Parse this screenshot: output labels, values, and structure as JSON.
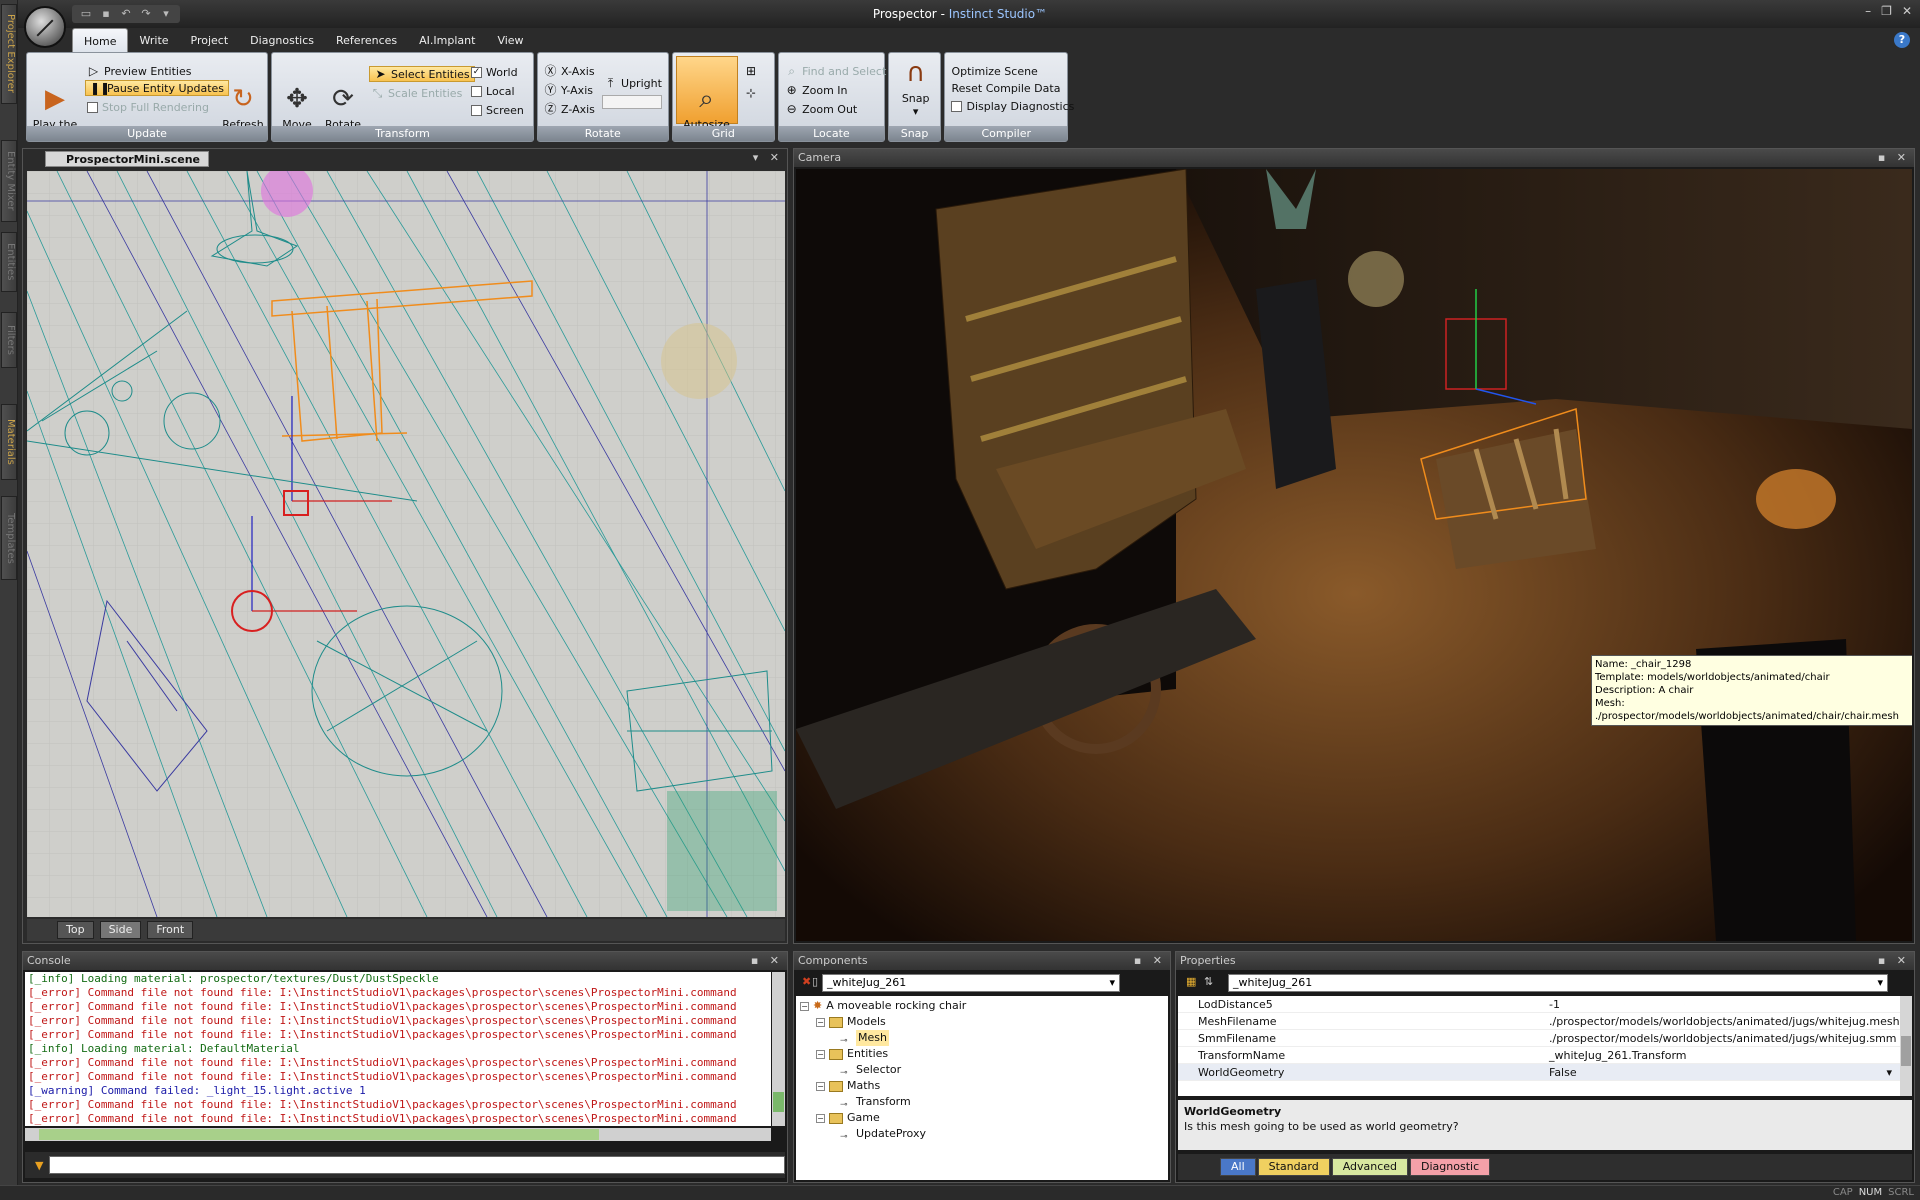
{
  "app": {
    "title": "Prospector",
    "separator": " - ",
    "subtitle": "Instinct Studio™"
  },
  "qat": [
    "open-icon",
    "save-icon",
    "undo-icon",
    "redo-icon",
    "dropdown-icon"
  ],
  "ribbon_tabs": [
    "Home",
    "Write",
    "Project",
    "Diagnostics",
    "References",
    "AI.Implant",
    "View"
  ],
  "ribbon": {
    "update": {
      "label": "Update",
      "play": "Play the\nGame",
      "preview": "Preview Entities",
      "pause": "Pause Entity Updates",
      "stop": "Stop Full Rendering",
      "refresh": "Refresh\nEntities"
    },
    "transform": {
      "label": "Transform",
      "move": "Move\nEntities",
      "rotate": "Rotate\nEntities",
      "select": "Select Entities",
      "scale": "Scale Entities",
      "world": "World",
      "local": "Local",
      "screen": "Screen"
    },
    "rotate": {
      "label": "Rotate",
      "x": "X-Axis",
      "y": "Y-Axis",
      "z": "Z-Axis",
      "upright": "Upright"
    },
    "grid": {
      "label": "Grid",
      "autosize": "Autosize\nMinor Lines"
    },
    "locate": {
      "label": "Locate",
      "find": "Find and Select",
      "zoomin": "Zoom In",
      "zoomout": "Zoom Out"
    },
    "snap": {
      "label": "Snap",
      "snap": "Snap"
    },
    "compiler": {
      "label": "Compiler",
      "optimize": "Optimize Scene",
      "reset": "Reset Compile Data",
      "display": "Display Diagnostics"
    }
  },
  "side_tabs": [
    "Project Explorer",
    "Entity Mixer",
    "Entities",
    "Filters",
    "Materials",
    "Templates"
  ],
  "scene": {
    "tab": "ProspectorMini.scene",
    "views": [
      "Top",
      "Side",
      "Front"
    ]
  },
  "camera": {
    "title": "Camera",
    "tooltip": {
      "name": "Name: _chair_1298",
      "template": "Template: models/worldobjects/animated/chair",
      "description": "Description: A chair",
      "mesh": "Mesh: ./prospector/models/worldobjects/animated/chair/chair.mesh"
    }
  },
  "console": {
    "title": "Console",
    "lines": [
      {
        "level": "info",
        "text": "[_info] Loading material: prospector/textures/Dust/DustSpeckle"
      },
      {
        "level": "error",
        "text": "[_error] Command file not found file: I:\\InstinctStudioV1\\packages\\prospector\\scenes\\ProspectorMini.command"
      },
      {
        "level": "error",
        "text": "[_error] Command file not found file: I:\\InstinctStudioV1\\packages\\prospector\\scenes\\ProspectorMini.command"
      },
      {
        "level": "error",
        "text": "[_error] Command file not found file: I:\\InstinctStudioV1\\packages\\prospector\\scenes\\ProspectorMini.command"
      },
      {
        "level": "error",
        "text": "[_error] Command file not found file: I:\\InstinctStudioV1\\packages\\prospector\\scenes\\ProspectorMini.command"
      },
      {
        "level": "info",
        "text": "[_info] Loading material: DefaultMaterial"
      },
      {
        "level": "error",
        "text": "[_error] Command file not found file: I:\\InstinctStudioV1\\packages\\prospector\\scenes\\ProspectorMini.command"
      },
      {
        "level": "error",
        "text": "[_error] Command file not found file: I:\\InstinctStudioV1\\packages\\prospector\\scenes\\ProspectorMini.command"
      },
      {
        "level": "warning",
        "text": "[_warning] Command failed: _light_15.light.active 1"
      },
      {
        "level": "error",
        "text": "[_error] Command file not found file: I:\\InstinctStudioV1\\packages\\prospector\\scenes\\ProspectorMini.command"
      },
      {
        "level": "error",
        "text": "[_error] Command file not found file: I:\\InstinctStudioV1\\packages\\prospector\\scenes\\ProspectorMini.command"
      }
    ],
    "input": ""
  },
  "components": {
    "title": "Components",
    "selected": "_whiteJug_261",
    "tree": [
      {
        "label": "A moveable rocking chair",
        "type": "root"
      },
      {
        "label": "Models",
        "type": "folder"
      },
      {
        "label": "Mesh",
        "type": "component",
        "selected": true
      },
      {
        "label": "Entities",
        "type": "folder"
      },
      {
        "label": "Selector",
        "type": "component"
      },
      {
        "label": "Maths",
        "type": "folder"
      },
      {
        "label": "Transform",
        "type": "component"
      },
      {
        "label": "Game",
        "type": "folder"
      },
      {
        "label": "UpdateProxy",
        "type": "component"
      }
    ]
  },
  "properties": {
    "title": "Properties",
    "selected": "_whiteJug_261",
    "rows": [
      {
        "name": "LodDistance5",
        "value": "-1"
      },
      {
        "name": "MeshFilename",
        "value": "./prospector/models/worldobjects/animated/jugs/whitejug.mesh"
      },
      {
        "name": "SmmFilename",
        "value": "./prospector/models/worldobjects/animated/jugs/whitejug.smm"
      },
      {
        "name": "TransformName",
        "value": "_whiteJug_261.Transform"
      },
      {
        "name": "WorldGeometry",
        "value": "False",
        "selected": true
      }
    ],
    "desc_title": "WorldGeometry",
    "desc_text": "Is this mesh going to be used as world geometry?",
    "tabs": [
      {
        "label": "All",
        "color": "#4a78c8"
      },
      {
        "label": "Standard",
        "color": "#f0d060"
      },
      {
        "label": "Advanced",
        "color": "#d8e8a0"
      },
      {
        "label": "Diagnostic",
        "color": "#f4a0a8"
      }
    ]
  },
  "status": [
    "CAP",
    "NUM",
    "SCRL"
  ]
}
